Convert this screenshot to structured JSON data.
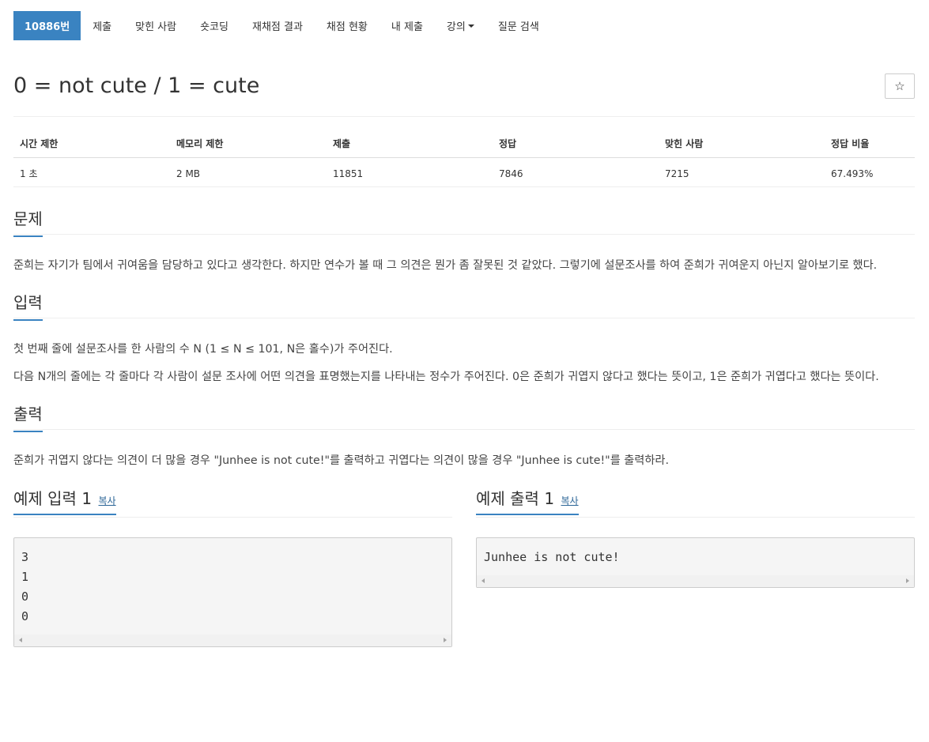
{
  "nav": {
    "items": [
      {
        "label": "10886번",
        "active": true
      },
      {
        "label": "제출"
      },
      {
        "label": "맞힌 사람"
      },
      {
        "label": "숏코딩"
      },
      {
        "label": "재채점 결과"
      },
      {
        "label": "채점 현황"
      },
      {
        "label": "내 제출"
      },
      {
        "label": "강의",
        "dropdown": true
      },
      {
        "label": "질문 검색"
      }
    ]
  },
  "problem": {
    "title": "0 = not cute / 1 = cute",
    "star_icon": "star-icon"
  },
  "info": {
    "headers": [
      "시간 제한",
      "메모리 제한",
      "제출",
      "정답",
      "맞힌 사람",
      "정답 비율"
    ],
    "values": [
      "1 초",
      "2 MB",
      "11851",
      "7846",
      "7215",
      "67.493%"
    ]
  },
  "sections": {
    "problem_title": "문제",
    "problem_text": "준희는 자기가 팀에서 귀여움을 담당하고 있다고 생각한다. 하지만 연수가 볼 때 그 의견은 뭔가 좀 잘못된 것 같았다. 그렇기에 설문조사를 하여 준희가 귀여운지 아닌지 알아보기로 했다.",
    "input_title": "입력",
    "input_text_1": "첫 번째 줄에 설문조사를 한 사람의 수 N (1 ≤ N ≤ 101, N은 홀수)가 주어진다.",
    "input_text_2": "다음 N개의 줄에는 각 줄마다 각 사람이 설문 조사에 어떤 의견을 표명했는지를 나타내는 정수가 주어진다. 0은 준희가 귀엽지 않다고 했다는 뜻이고, 1은 준희가 귀엽다고 했다는 뜻이다.",
    "output_title": "출력",
    "output_text": "준희가 귀엽지 않다는 의견이 더 많을 경우 \"Junhee is not cute!\"를 출력하고 귀엽다는 의견이 많을 경우 \"Junhee is cute!\"를 출력하라."
  },
  "samples": {
    "input_title": "예제 입력 1",
    "output_title": "예제 출력 1",
    "copy_label": "복사",
    "input_text": "3\n1\n0\n0",
    "output_text": "Junhee is not cute!"
  }
}
